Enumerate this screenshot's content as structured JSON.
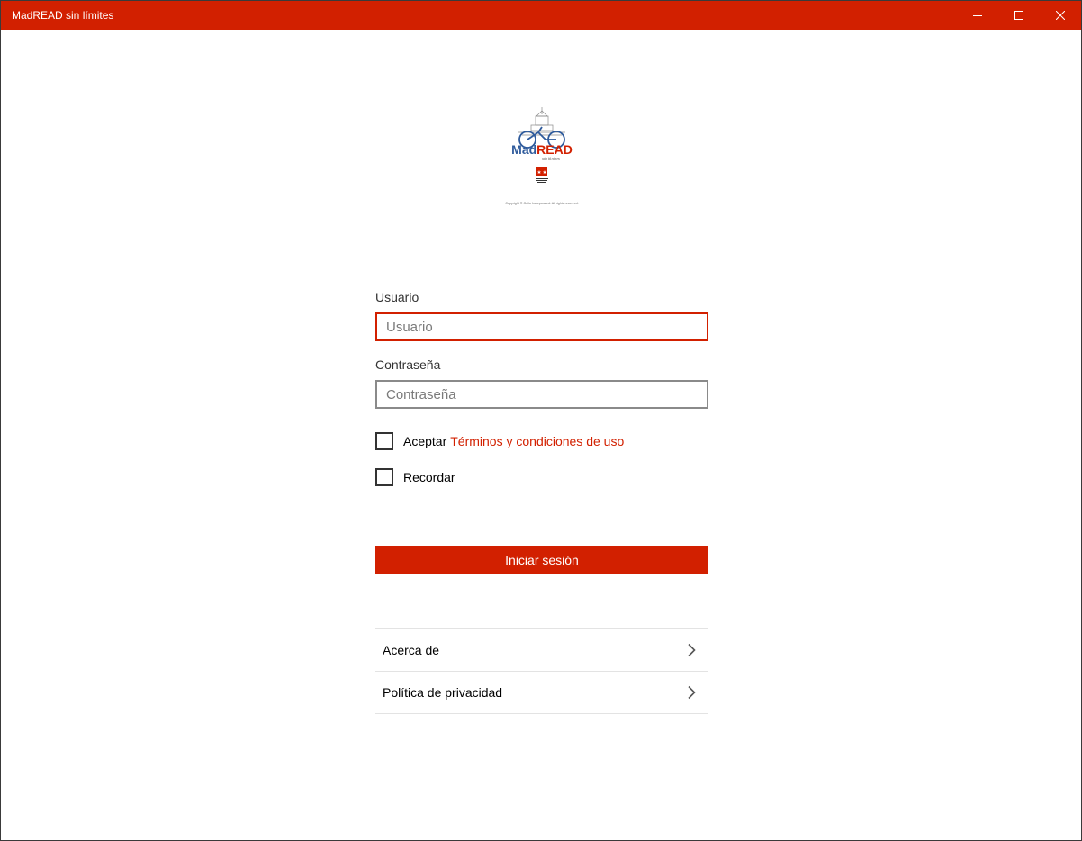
{
  "window": {
    "title": "MadREAD sin límites",
    "accent_color": "#d22000"
  },
  "logo": {
    "text_mad": "Mad",
    "text_read": "READ",
    "tagline": "sin límites",
    "copyright": "Copyright © Odilo Incorporated. All rights reserved."
  },
  "form": {
    "username_label": "Usuario",
    "username_placeholder": "Usuario",
    "username_value": "",
    "password_label": "Contraseña",
    "password_placeholder": "Contraseña",
    "password_value": "",
    "accept_prefix": "Aceptar",
    "terms_link": "Términos y condiciones de uso",
    "accept_checked": false,
    "remember_label": "Recordar",
    "remember_checked": false,
    "login_button": "Iniciar sesión"
  },
  "menu": {
    "items": [
      {
        "label": "Acerca de",
        "icon": "chevron-right-icon"
      },
      {
        "label": "Política de privacidad",
        "icon": "chevron-right-icon"
      }
    ]
  }
}
